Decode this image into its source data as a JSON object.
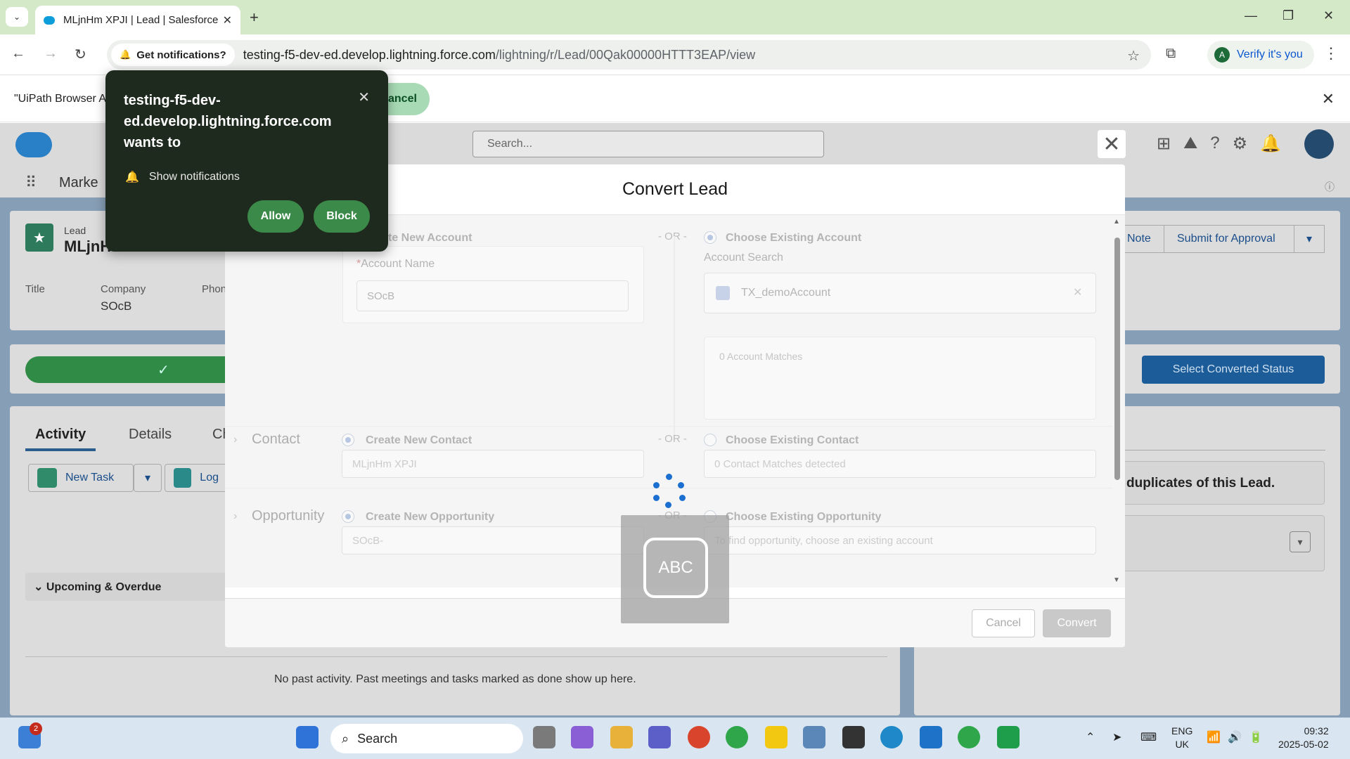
{
  "browser": {
    "tab_title": "MLjnHm XPJI | Lead | Salesforce",
    "notif_chip": "Get notifications?",
    "url_domain": "testing-f5-dev-ed.develop.lightning.force.com",
    "url_path": "/lightning/r/Lead/00Qak00000HTTT3EAP/view",
    "verify_label": "Verify it's you",
    "verify_avatar": "A"
  },
  "infobar": {
    "text": "\"UiPath Browser A",
    "cancel_label": "ancel"
  },
  "permission_popup": {
    "site": "testing-f5-dev-ed.develop.lightning.force.com wants to",
    "permission": "Show notifications",
    "allow": "Allow",
    "block": "Block"
  },
  "salesforce": {
    "search_placeholder": "Search...",
    "app_name": "Marke",
    "lead_label": "Lead",
    "lead_name": "MLjnH",
    "fields": {
      "title_label": "Title",
      "company_label": "Company",
      "company_value": "SOcB",
      "phone_label": "Phon"
    },
    "tabs": [
      "Activity",
      "Details",
      "Ch"
    ],
    "new_task": "New Task",
    "log_call": "Log",
    "upcoming": "Upcoming & Overdue",
    "no_activity": "No past activity. Past meetings and tasks marked as done show up here.",
    "right_buttons": [
      "Note",
      "Submit for Approval"
    ],
    "select_status": "Select Converted Status",
    "duplicates": "duplicates of this Lead."
  },
  "modal": {
    "title": "Convert Lead",
    "account": {
      "create_label": "te New Account",
      "or": "- OR -",
      "existing_label": "Choose Existing Account",
      "account_name_label": "Account Name",
      "account_name_value": "SOcB",
      "account_search_label": "Account Search",
      "account_search_value": "TX_demoAccount",
      "matches": "0 Account Matches"
    },
    "contact": {
      "section": "Contact",
      "create_label": "Create New Contact",
      "or": "- OR -",
      "existing_label": "Choose Existing Contact",
      "new_value": "MLjnHm XPJI",
      "matches": "0 Contact Matches detected"
    },
    "opportunity": {
      "section": "Opportunity",
      "create_label": "Create New Opportunity",
      "or": "- OR -",
      "existing_label": "Choose Existing Opportunity",
      "new_value": "SOcB-",
      "hint": "To find opportunity, choose an existing account"
    },
    "cancel": "Cancel",
    "convert": "Convert"
  },
  "overlay": {
    "abc": "ABC"
  },
  "taskbar": {
    "search": "Search",
    "notification_count": "2",
    "lang_top": "ENG",
    "lang_bottom": "UK",
    "time": "09:32",
    "date": "2025-05-02"
  }
}
